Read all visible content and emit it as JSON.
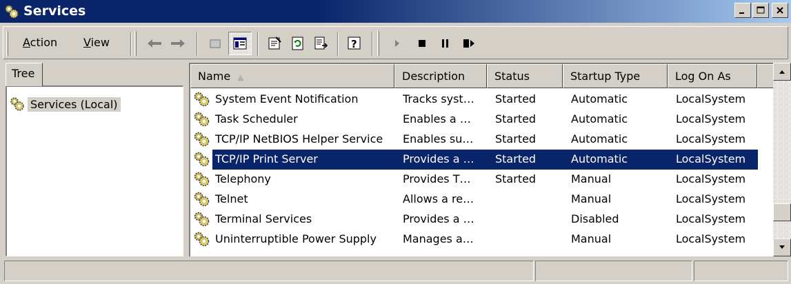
{
  "window": {
    "title": "Services",
    "title_icon": "services-gears-icon"
  },
  "caption_buttons": {
    "minimize": "minimize-icon",
    "maximize": "maximize-icon",
    "close": "close-icon"
  },
  "menu": {
    "action": "Action",
    "action_mnemonic": "A",
    "view": "View",
    "view_mnemonic": "V"
  },
  "toolbar_icons": [
    "back-arrow-icon",
    "forward-arrow-icon",
    "up-level-icon",
    "show-hide-tree-icon",
    "properties-icon",
    "refresh-icon",
    "export-list-icon",
    "help-icon",
    "start-service-icon",
    "stop-service-icon",
    "pause-service-icon",
    "restart-service-icon"
  ],
  "left_tab": {
    "label": "Tree"
  },
  "tree": {
    "root": "Services (Local)"
  },
  "columns": {
    "name": "Name",
    "description": "Description",
    "status": "Status",
    "startup": "Startup Type",
    "logon": "Log On As"
  },
  "rows": [
    {
      "name": "System Event Notification",
      "description": "Tracks syst…",
      "status": "Started",
      "startup": "Automatic",
      "logon": "LocalSystem"
    },
    {
      "name": "Task Scheduler",
      "description": "Enables a …",
      "status": "Started",
      "startup": "Automatic",
      "logon": "LocalSystem"
    },
    {
      "name": "TCP/IP NetBIOS Helper Service",
      "description": "Enables su…",
      "status": "Started",
      "startup": "Automatic",
      "logon": "LocalSystem"
    },
    {
      "name": "TCP/IP Print Server",
      "description": "Provides a …",
      "status": "Started",
      "startup": "Automatic",
      "logon": "LocalSystem",
      "selected": true
    },
    {
      "name": "Telephony",
      "description": "Provides T…",
      "status": "Started",
      "startup": "Manual",
      "logon": "LocalSystem"
    },
    {
      "name": "Telnet",
      "description": "Allows a re…",
      "status": "",
      "startup": "Manual",
      "logon": "LocalSystem"
    },
    {
      "name": "Terminal Services",
      "description": "Provides a …",
      "status": "",
      "startup": "Disabled",
      "logon": "LocalSystem"
    },
    {
      "name": "Uninterruptible Power Supply",
      "description": "Manages a…",
      "status": "",
      "startup": "Manual",
      "logon": "LocalSystem"
    }
  ],
  "colors": {
    "title_start": "#0a246a",
    "title_end": "#a6caf0",
    "selection": "#0a246a",
    "face": "#d4d0c8"
  }
}
